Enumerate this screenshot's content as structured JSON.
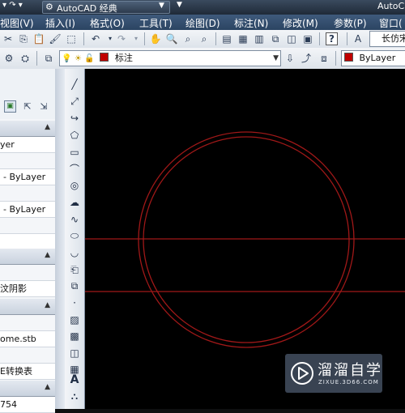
{
  "titlebar": {
    "workspace_label": "AutoCAD 经典",
    "app_name_partial": "AutoCa"
  },
  "menubar": {
    "items": [
      "视图(V)",
      "插入(I)",
      "格式(O)",
      "工具(T)",
      "绘图(D)",
      "标注(N)",
      "修改(M)",
      "参数(P)",
      "窗口("
    ]
  },
  "toolbar1": {
    "text_style_partial": "长仿宋"
  },
  "toolbar2": {
    "layer_name": "标注",
    "color_value": "ByLayer"
  },
  "left_panel": {
    "rows": [
      "yer",
      "- ByLayer",
      "- ByLayer",
      "汶阴影",
      "ome.stb",
      "E转换表",
      "754"
    ]
  },
  "colors": {
    "drawing_geometry": "#a01818",
    "canvas_background": "#000000",
    "menubar_bg": "#2b4462"
  },
  "watermark": {
    "title": "溜溜自学",
    "url": "ZIXUE.3D66.COM"
  }
}
